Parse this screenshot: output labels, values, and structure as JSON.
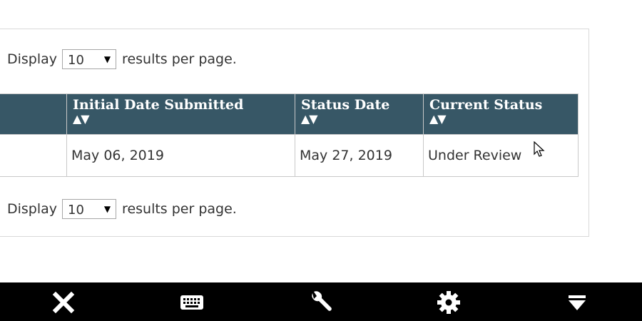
{
  "pagination_top": {
    "display_label": "Display",
    "per_page_value": "10",
    "suffix_label": "results per page."
  },
  "pagination_bottom": {
    "display_label": "Display",
    "per_page_value": "10",
    "suffix_label": "results per page."
  },
  "table": {
    "columns": [
      {
        "label": ""
      },
      {
        "label": "Initial Date Submitted",
        "sort": "▲▼"
      },
      {
        "label": "Status Date",
        "sort": "▲▼"
      },
      {
        "label": "Current Status",
        "sort": "▲▼"
      }
    ],
    "rows": [
      {
        "first": "",
        "initial_date": "May 06, 2019",
        "status_date": "May 27, 2019",
        "current_status": "Under Review"
      }
    ]
  },
  "toolbar": {
    "icons": [
      "close-icon",
      "keyboard-icon",
      "wrench-icon",
      "gear-icon",
      "dropdown-menu-icon"
    ]
  },
  "colors": {
    "header_bg": "#375766",
    "toolbar_bg": "#000000"
  }
}
